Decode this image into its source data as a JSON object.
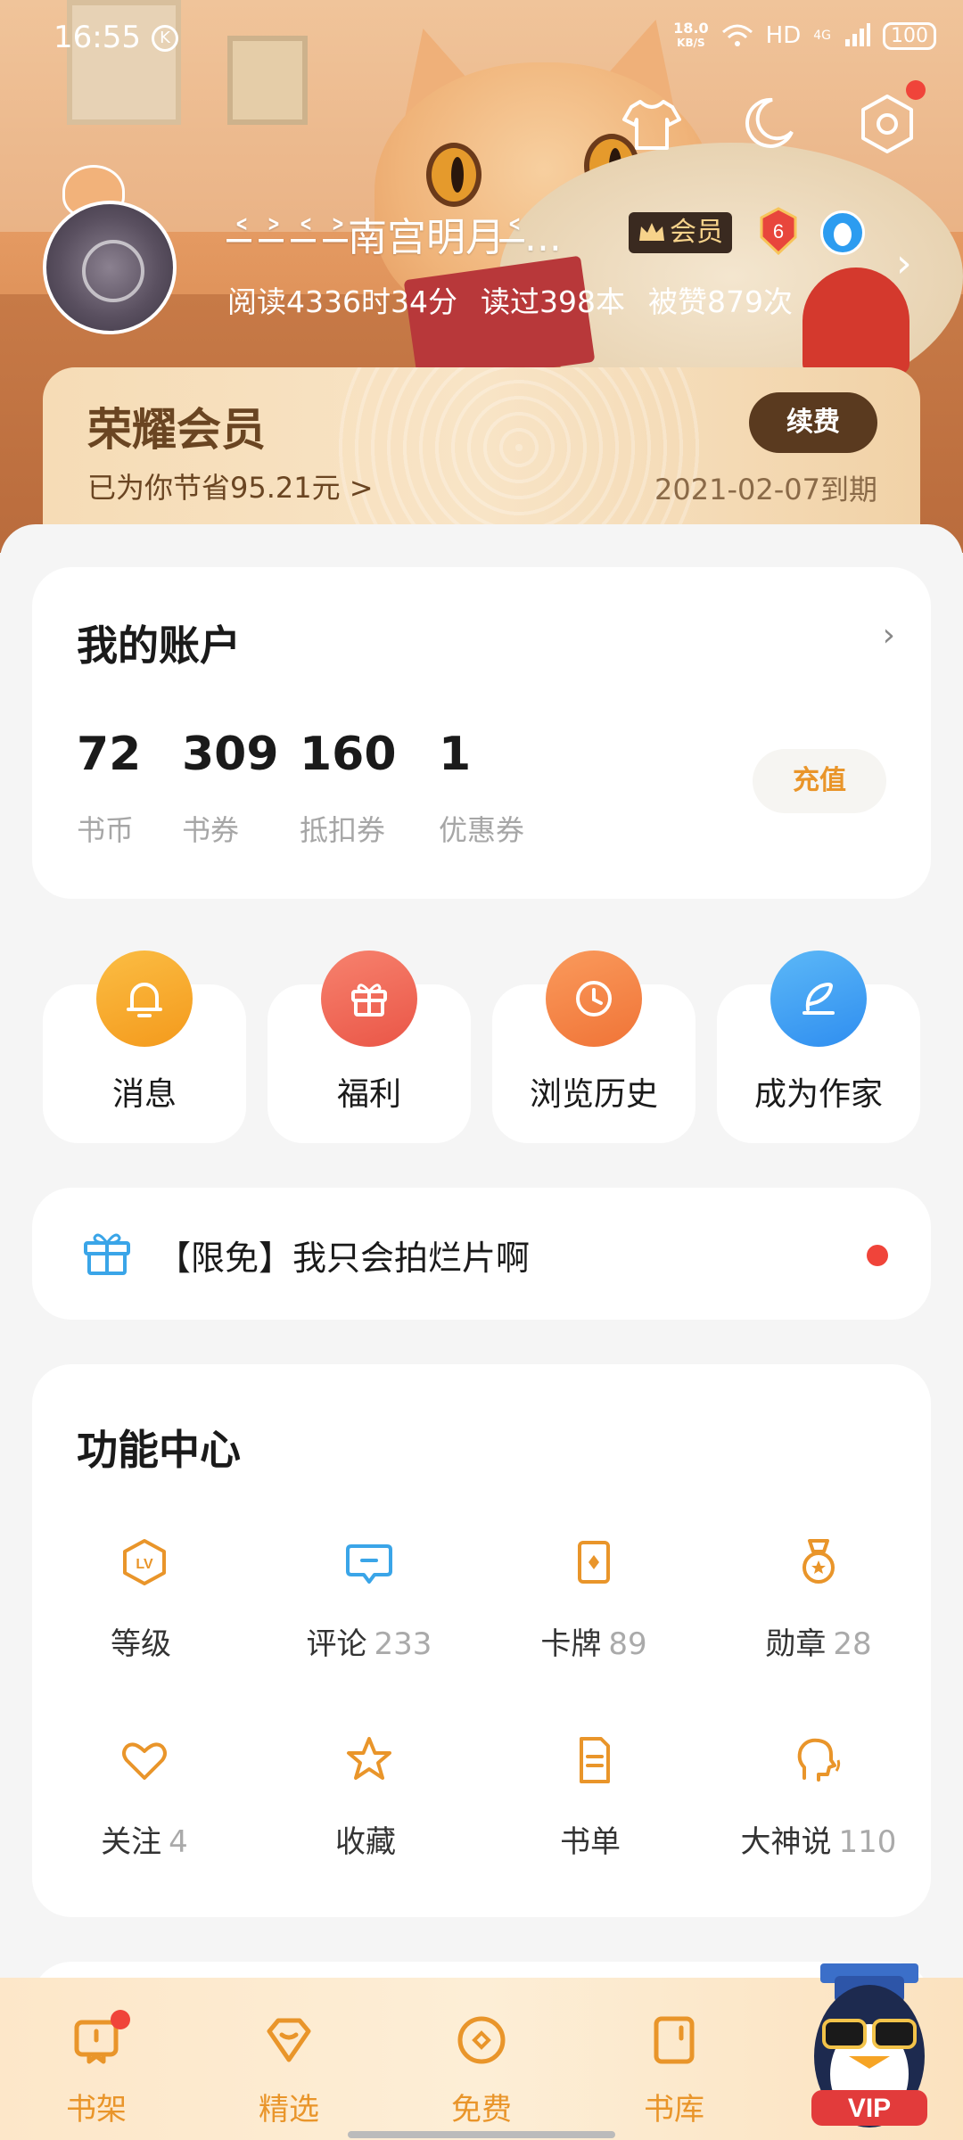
{
  "status_bar": {
    "time": "16:55",
    "k_badge": "K",
    "speed_value": "18.0",
    "speed_unit": "KB/S",
    "hd": "HD",
    "network": "4G",
    "battery": "100"
  },
  "profile": {
    "username": "˂̶ ˃̶ ˂̶ ˃̶南宫明月˂̶...",
    "vip_badge_label": "会员",
    "level": "6",
    "stats": {
      "reading_time": "阅读4336时34分",
      "books_read": "读过398本",
      "likes": "被赞879次"
    }
  },
  "vip_card": {
    "title": "荣耀会员",
    "saved": "已为你节省95.21元 >",
    "renew_button": "续费",
    "expiry": "2021-02-07到期"
  },
  "account": {
    "title": "我的账户",
    "items": [
      {
        "value": "72",
        "label": "书币"
      },
      {
        "value": "309",
        "label": "书券"
      },
      {
        "value": "160",
        "label": "抵扣券"
      },
      {
        "value": "1",
        "label": "优惠券"
      }
    ],
    "recharge_button": "充值"
  },
  "quick_entries": [
    {
      "label": "消息",
      "icon": "bell-icon",
      "color": "#f7a92c"
    },
    {
      "label": "福利",
      "icon": "gift-icon",
      "color": "#f06b5a"
    },
    {
      "label": "浏览历史",
      "icon": "clock-icon",
      "color": "#f5894a"
    },
    {
      "label": "成为作家",
      "icon": "pen-icon",
      "color": "#3ea2f1"
    }
  ],
  "promo": {
    "text": "【限免】我只会拍烂片啊"
  },
  "function_center": {
    "title": "功能中心",
    "items": [
      {
        "label": "等级",
        "count": "",
        "icon": "level-icon"
      },
      {
        "label": "评论",
        "count": "233",
        "icon": "comment-icon"
      },
      {
        "label": "卡牌",
        "count": "89",
        "icon": "card-icon"
      },
      {
        "label": "勋章",
        "count": "28",
        "icon": "medal-icon"
      },
      {
        "label": "关注",
        "count": "4",
        "icon": "heart-icon"
      },
      {
        "label": "收藏",
        "count": "",
        "icon": "star-icon"
      },
      {
        "label": "书单",
        "count": "",
        "icon": "booklist-icon"
      },
      {
        "label": "大神说",
        "count": "110",
        "icon": "talk-icon"
      }
    ]
  },
  "bottom_nav": [
    {
      "label": "书架",
      "icon": "bookshelf-icon"
    },
    {
      "label": "精选",
      "icon": "featured-icon"
    },
    {
      "label": "免费",
      "icon": "free-icon"
    },
    {
      "label": "书库",
      "icon": "library-icon"
    }
  ],
  "mascot_label": "VIP",
  "colors": {
    "accent": "#e9952a",
    "vip_brown": "#5a3a1f",
    "notify_red": "#f0443a"
  }
}
